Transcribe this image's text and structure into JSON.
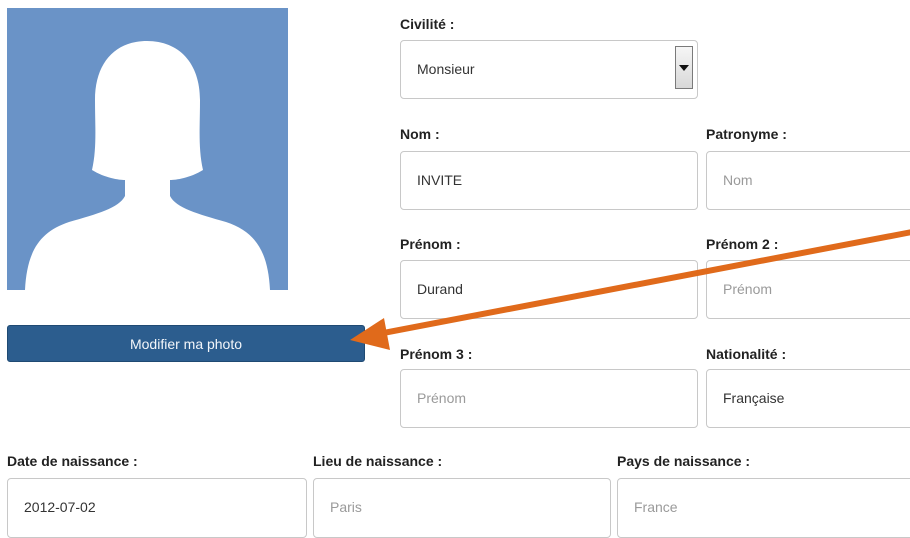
{
  "profile": {
    "photo_button_label": "Modifier ma photo"
  },
  "form": {
    "civilite": {
      "label": "Civilité :",
      "value": "Monsieur"
    },
    "nom": {
      "label": "Nom :",
      "value": "INVITE"
    },
    "patronyme": {
      "label": "Patronyme :",
      "placeholder": "Nom"
    },
    "prenom": {
      "label": "Prénom :",
      "value": "Durand"
    },
    "prenom2": {
      "label": "Prénom 2 :",
      "placeholder": "Prénom"
    },
    "prenom3": {
      "label": "Prénom 3 :",
      "placeholder": "Prénom"
    },
    "nationalite": {
      "label": "Nationalité :",
      "value": "Française"
    },
    "date_naissance": {
      "label": "Date de naissance :",
      "value": "2012-07-02"
    },
    "lieu_naissance": {
      "label": "Lieu de naissance :",
      "placeholder": "Paris"
    },
    "pays_naissance": {
      "label": "Pays de naissance :",
      "placeholder": "France"
    }
  },
  "colors": {
    "avatar_bg": "#6a93c7",
    "button_bg": "#2c5d8e",
    "arrow": "#e06a1b"
  },
  "icons": {
    "avatar": "person-silhouette-icon",
    "select_arrow": "chevron-down-icon",
    "annotation": "arrow-icon"
  }
}
